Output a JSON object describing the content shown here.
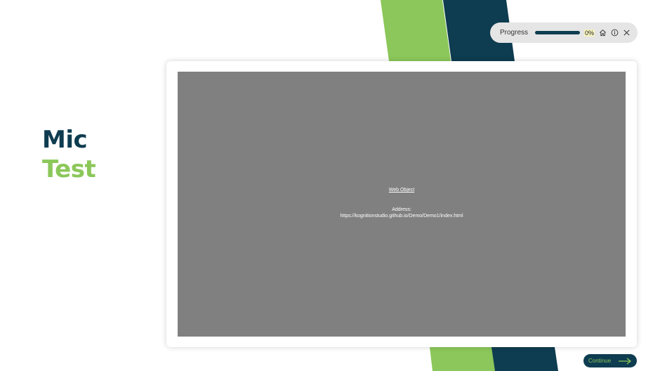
{
  "page": {
    "title_line1": "Mic",
    "title_line2": "Test"
  },
  "progress": {
    "label": "Progress",
    "value_text": "0%",
    "value": 0
  },
  "toolbar": {
    "icons": [
      "home-icon",
      "info-icon",
      "close-icon"
    ]
  },
  "web_object": {
    "title": "Web Object",
    "address_label": "Address:",
    "address": "https://kognitionstudio.github.io/Demo/Demo1/index.html"
  },
  "continue_button": {
    "label": "Continue"
  },
  "colors": {
    "navy": "#0e3c50",
    "green": "#8bc75a",
    "placeholder_gray": "#808080"
  }
}
